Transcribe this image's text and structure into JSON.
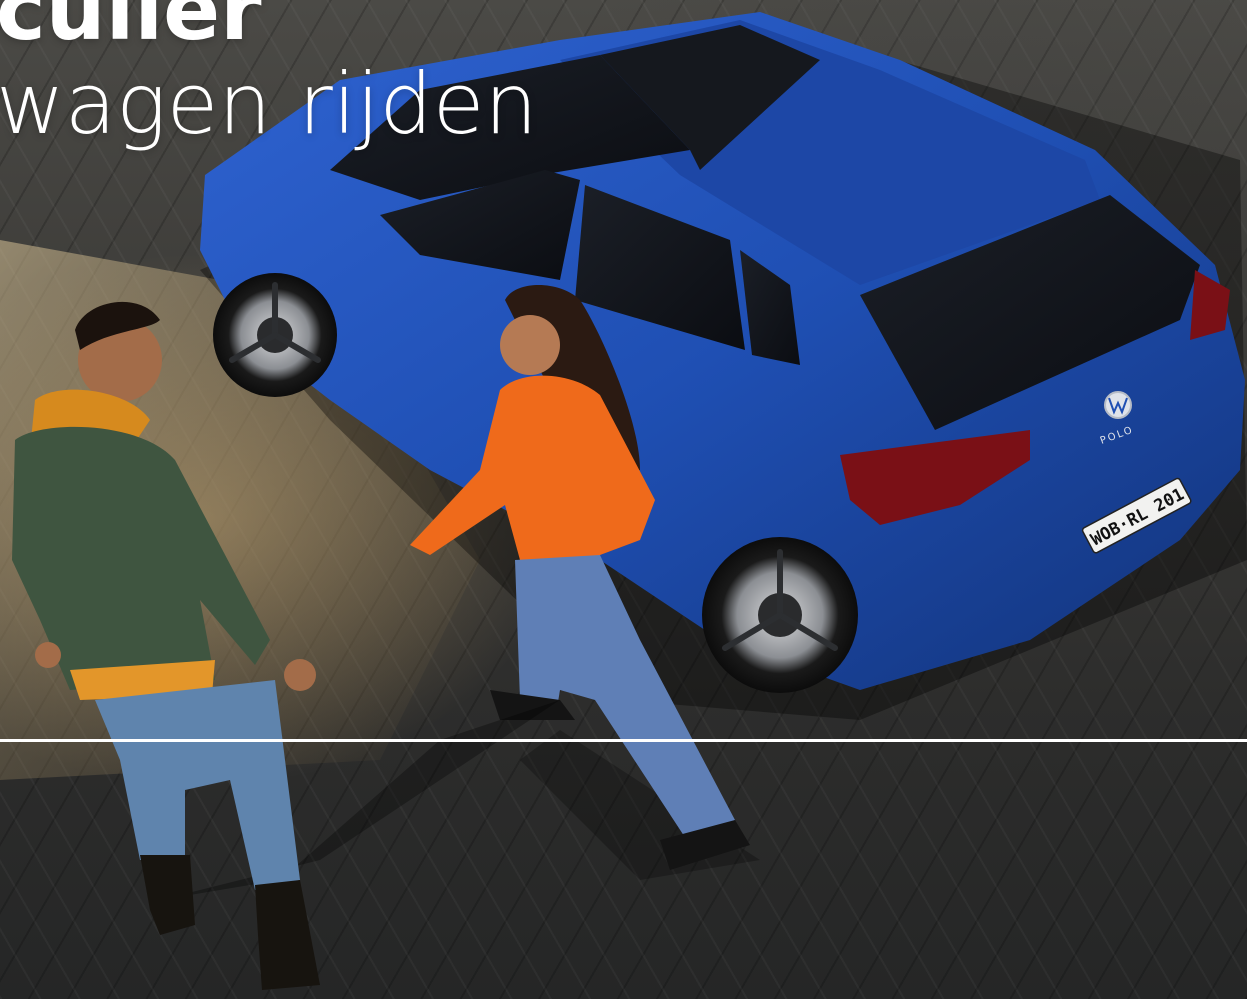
{
  "headline": {
    "line1": "culier",
    "line2": "wagen rijden"
  },
  "car": {
    "model_badge": "POLO",
    "license_plate": "WOB·RL 201",
    "color": "#1f4fb3"
  },
  "colors": {
    "headline_text": "#ffffff",
    "divider": "#ffffff",
    "ground_light": "#b49a6a",
    "ground_dark": "#2a2b2c"
  }
}
